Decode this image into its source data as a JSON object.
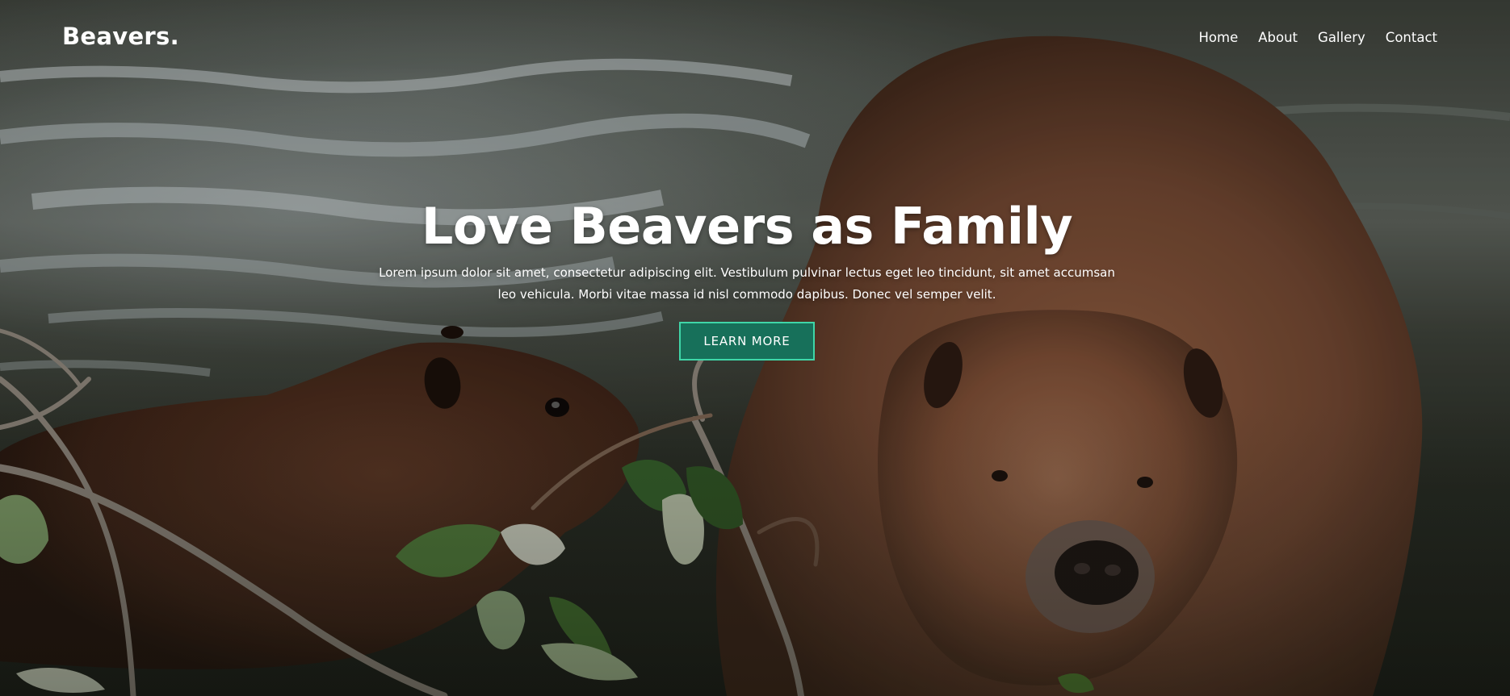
{
  "nav": {
    "brand": "Beavers.",
    "links": [
      "Home",
      "About",
      "Gallery",
      "Contact"
    ]
  },
  "hero": {
    "title": "Love Beavers as Family",
    "text": "Lorem ipsum dolor sit amet, consectetur adipiscing elit. Vestibulum pulvinar lectus eget leo tincidunt, sit amet accumsan leo vehicula. Morbi vitae massa id nisl commodo dapibus. Donec vel semper velit.",
    "button_label": "LEARN MORE",
    "background_image": "beavers-photo"
  },
  "colors": {
    "button_bg": "#17705a",
    "button_border": "#3fd6a8",
    "text": "#ffffff"
  }
}
